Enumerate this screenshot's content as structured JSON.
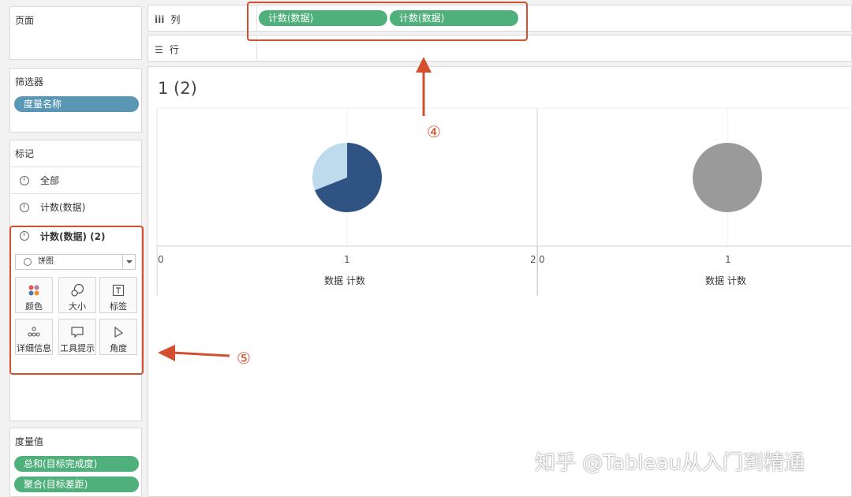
{
  "left": {
    "pages_title": "页面",
    "filters_title": "筛选器",
    "filter_pill": "度量名称",
    "marks_title": "标记",
    "marks_rows": [
      "全部",
      "计数(数据)",
      "计数(数据) (2)"
    ],
    "mark_type": "饼图",
    "buttons": [
      "颜色",
      "大小",
      "标签",
      "详细信息",
      "工具提示",
      "角度"
    ],
    "measure_values_title": "度量值",
    "measure_pills": [
      "总和(目标完成度)",
      "聚合(目标差距)"
    ]
  },
  "shelves": {
    "columns_label": "列",
    "columns_pills": [
      "计数(数据)",
      "计数(数据)"
    ],
    "rows_label": "行"
  },
  "view": {
    "title": "1 (2)",
    "left_axis_ticks": [
      "0",
      "1",
      "2"
    ],
    "right_axis_ticks": [
      "0",
      "1"
    ],
    "axis_title_left": "数据 计数",
    "axis_title_right": "数据 计数"
  },
  "annotations": {
    "label_4": "④",
    "label_5": "⑤"
  },
  "watermark": "知乎 @Tableau从入门到精通",
  "colors": {
    "pie_dark": "#2f5483",
    "pie_light": "#bedbed",
    "pie_gray": "#9a9a9a",
    "pill_green": "#4fb07c",
    "pill_blue": "#5a97b5",
    "annotation": "#d2502f"
  },
  "pie_left_fraction_dark": 0.69
}
